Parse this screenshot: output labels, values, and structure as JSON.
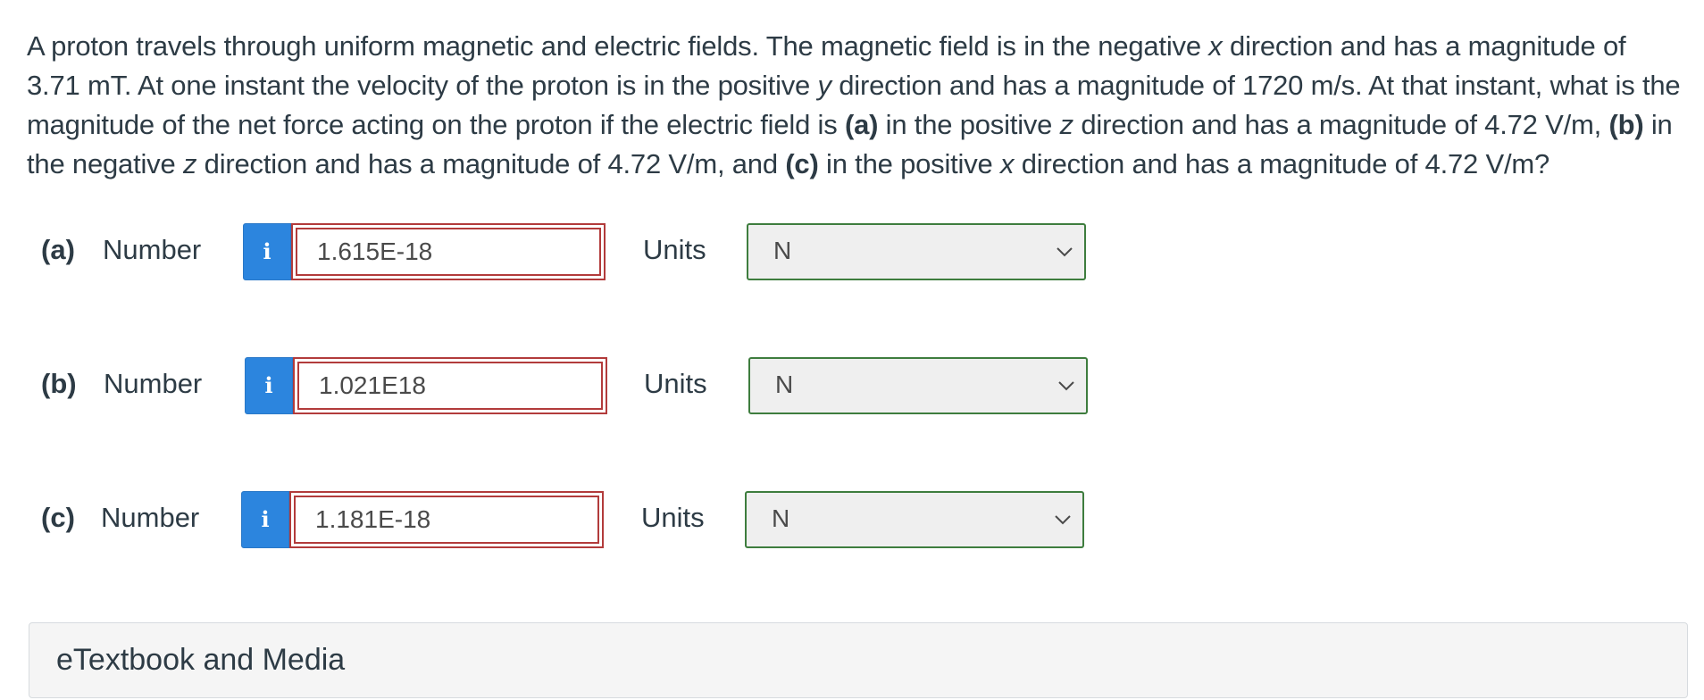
{
  "question": {
    "p1": "A proton travels through uniform magnetic and electric fields. The magnetic field is in the negative ",
    "v1": "x",
    "p2": " direction and has a magnitude of 3.71 mT. At one instant the velocity of the proton is in the positive ",
    "v2": "y",
    "p3": " direction and has a magnitude of 1720 m/s. At that instant, what is the magnitude of the net force acting on the proton if the electric field is ",
    "b1": "(a)",
    "p4": " in the positive ",
    "v3": "z",
    "p5": " direction and has a magnitude of 4.72 V/m, ",
    "b2": "(b)",
    "p6": " in the negative ",
    "v4": "z",
    "p7": " direction and has a magnitude of 4.72 V/m, and ",
    "b3": "(c)",
    "p8": " in the positive ",
    "v5": "x",
    "p9": " direction and has a magnitude of 4.72 V/m?"
  },
  "answers": [
    {
      "part": "(a)",
      "number_label": "Number",
      "info_glyph": "i",
      "value": "1.615E-18",
      "units_label": "Units",
      "unit": "N"
    },
    {
      "part": "(b)",
      "number_label": "Number",
      "info_glyph": "i",
      "value": "1.021E18",
      "units_label": "Units",
      "unit": "N"
    },
    {
      "part": "(c)",
      "number_label": "Number",
      "info_glyph": "i",
      "value": "1.181E-18",
      "units_label": "Units",
      "unit": "N"
    }
  ],
  "etextbook": {
    "title": "eTextbook and Media"
  },
  "colors": {
    "info_button": "#2c85de",
    "input_border_incorrect": "#b23b3b",
    "select_border": "#3e7d3e",
    "text": "#2d3b45"
  },
  "icons": {
    "info": "info-icon",
    "dropdown": "chevron-down-icon"
  }
}
